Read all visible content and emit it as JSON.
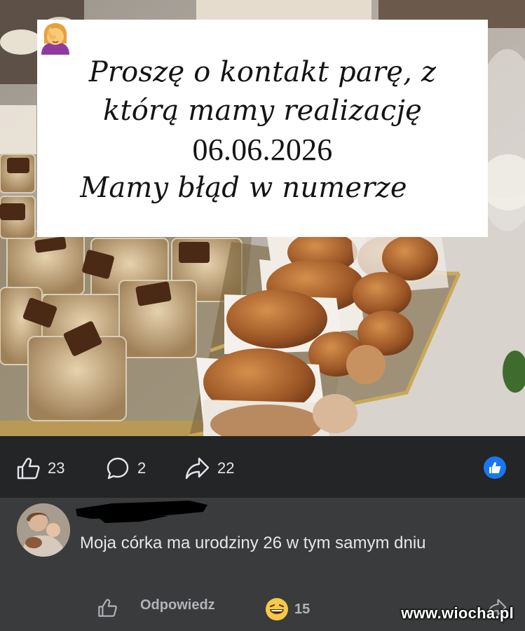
{
  "post": {
    "caption_lines": [
      "Proszę o kontakt parę, z",
      "którą mamy realizację",
      "06.06.2026",
      "Mamy błąd w numerze"
    ],
    "caption_emoji": "facepalm-emoji"
  },
  "actions": {
    "likes": "23",
    "comments": "2",
    "shares": "22"
  },
  "comment": {
    "text": "Moja córka ma urodziny 26 w tym samym dniu",
    "reply_label": "Odpowiedz",
    "reaction_count": "15"
  },
  "watermark": "www.wiocha.pl",
  "colors": {
    "accent_blue": "#1877f2",
    "bar_bg": "#242526",
    "comment_bg": "#3a3b3c",
    "text_light": "#e4e6eb",
    "text_muted": "#b0b3b8"
  }
}
